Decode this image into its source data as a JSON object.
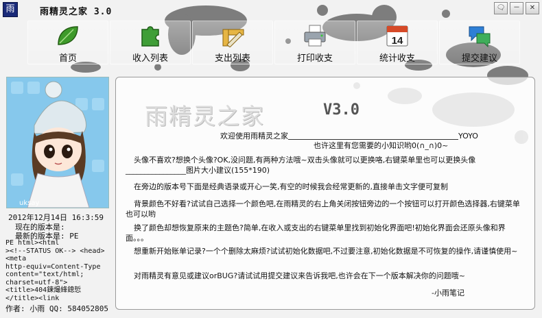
{
  "window": {
    "title": "雨精灵之家  3.0",
    "logo_char": "雨",
    "buttons": [
      "🗨",
      "－",
      "✕"
    ]
  },
  "toolbar": {
    "items": [
      {
        "label": "首页",
        "icon": "leaf-icon"
      },
      {
        "label": "收入列表",
        "icon": "puzzle-icon"
      },
      {
        "label": "支出列表",
        "icon": "ruler-pencil-icon"
      },
      {
        "label": "打印收支",
        "icon": "printer-icon"
      },
      {
        "label": "统计收支",
        "icon": "calendar-icon"
      },
      {
        "label": "提交建议",
        "icon": "chat-bubbles-icon"
      }
    ],
    "calendar_number": "14"
  },
  "sidebar": {
    "avatar_caption": "uksay",
    "date_time": "2012年12月14日  16:3:59",
    "current_version_label": "现在的版本是:",
    "latest_version_label": "最新的版本是: PE",
    "raw_html": "PE html><html\n><!--STATUS OK--> <head>\n<meta\nhttp-equiv=Content-Type\ncontent=\"text/html;\ncharset=utf-8\">\n<title>404鍊熶綘鎴悊\n</title><link",
    "author": "作者: 小雨 QQ: 584052805"
  },
  "main": {
    "app_name": "雨精灵之家",
    "version": "V3.0",
    "welcome": "欢迎使用雨精灵之家",
    "welcome_suffix": "YOYO",
    "hint": "也许这里有您需要的小知识哟0(∩_∩)0~",
    "paragraphs": [
      "头像不喜欢?想换个头像?OK,没问题,有两种方法哦~双击头像就可以更换咯,右键菜单里也可以更换头像________________图片大小建议(155*190)",
      "在旁边的版本号下面是经典语录或开心一笑,有空的时候我会经常更新的,直接单击文字便可复制",
      "背景颜色不好看?试试自己选择一个颜色吧,在雨精灵的右上角关闭按钮旁边的一个按钮可以打开颜色选择器,右键菜单也可以哟",
      "换了颜色却想恢复原来的主题色?简单,在收入或支出的右键菜单里找到初始化界面吧!初始化界面会还原头像和界面。。。",
      "想重新开始账单记录?一个个删除太麻烦?试试初始化数据吧,不过要注意,初始化数据是不可恢复的操作,请谨慎使用~",
      "对雨精灵有意见或建议orBUG?请试试用提交建议来告诉我吧,也许会在下一个版本解决你的问题哦~"
    ],
    "signature": "-小雨笔记"
  }
}
